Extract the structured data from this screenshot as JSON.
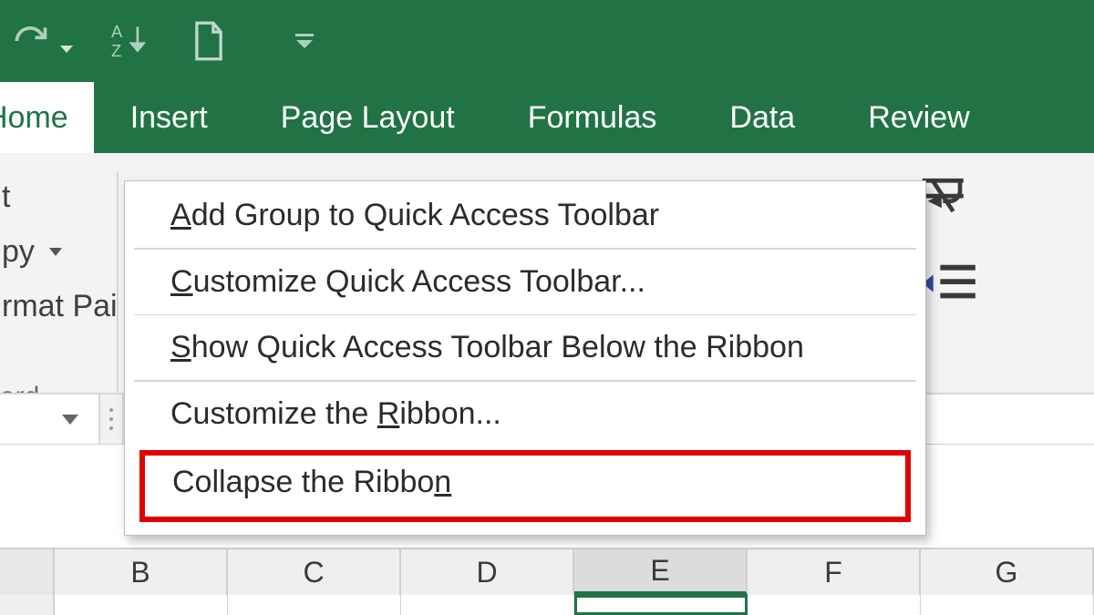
{
  "qat": {
    "redo": "redo",
    "sort": "sort",
    "newdoc": "new-document",
    "customize": "customize-quick-access-toolbar"
  },
  "tabs": {
    "home": "Home",
    "insert": "Insert",
    "pagelayout": "Page Layout",
    "formulas": "Formulas",
    "data": "Data",
    "review": "Review"
  },
  "clipboard": {
    "cut_partial": "t",
    "copy_partial": "py",
    "formatpainter_partial": "rmat Pai",
    "group_caption": "ard"
  },
  "context_menu": {
    "add": {
      "pre": "",
      "u": "A",
      "post": "dd Group to Quick Access Toolbar"
    },
    "customize_qat": {
      "pre": "",
      "u": "C",
      "post": "ustomize Quick Access Toolbar..."
    },
    "show_below": {
      "pre": "",
      "u": "S",
      "post": "how Quick Access Toolbar Below the Ribbon"
    },
    "customize_ribbon": {
      "pre": "Customize the ",
      "u": "R",
      "post": "ibbon..."
    },
    "collapse": {
      "pre": "Collapse the Ribbo",
      "u": "n",
      "post": ""
    }
  },
  "columns": [
    "B",
    "C",
    "D",
    "E",
    "F",
    "G"
  ],
  "active_column_index": 3
}
